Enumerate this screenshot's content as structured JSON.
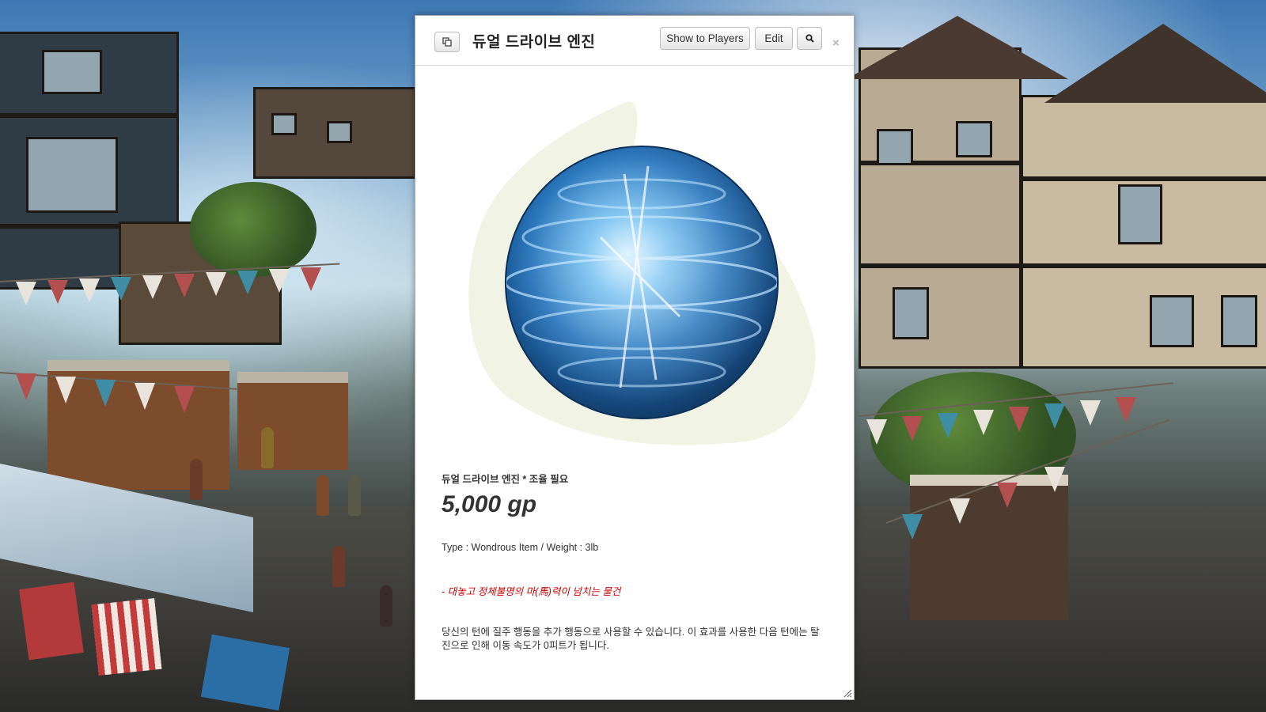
{
  "dialog": {
    "title": "듀얼 드라이브 엔진",
    "buttons": {
      "show_to_players": "Show to Players",
      "edit": "Edit"
    },
    "icons": {
      "popout": "popout-icon",
      "search": "search-icon",
      "close": "close-icon",
      "resize": "resize-grip-icon"
    },
    "close_glyph": "×",
    "item": {
      "subtitle": "듀얼 드라이브 엔진 * 조율 필요",
      "price": "5,000 gp",
      "type_line": "Type : Wondrous Item / Weight : 3lb",
      "flavor": "- 대놓고 정체불명의 마(馬)력이 넘치는 물건",
      "description": "당신의 턴에 질주 행동을 추가 행동으로 사용할 수 있습니다. 이 효과를 사용한 다음 턴에는 탈진으로 인해 이동 속도가 0피트가 됩니다."
    },
    "colors": {
      "flavor_text": "#d00000",
      "orb": "#2a7fd0"
    }
  }
}
